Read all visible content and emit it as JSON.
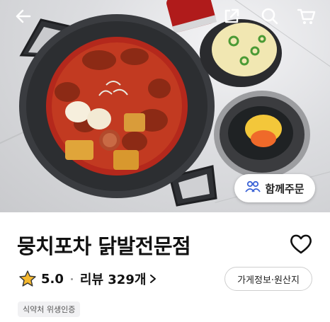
{
  "hero": {
    "image_desc": "dakbal stew food photo",
    "order_together_label": "함께주문"
  },
  "store": {
    "name": "뭉치포차 닭발전문점",
    "rating": "5.0",
    "reviews_label": "리뷰 329개",
    "info_button_label": "가게정보·원산지",
    "badge_label": "식약처 위생인증"
  },
  "icons": {
    "back": "back-arrow-icon",
    "share": "share-icon",
    "search": "search-icon",
    "cart": "cart-icon",
    "heart": "heart-icon",
    "star": "star-icon",
    "group": "group-people-icon",
    "chevron": "chevron-right-icon"
  },
  "colors": {
    "star": "#f5b82e",
    "group_icon": "#3a62d6"
  }
}
